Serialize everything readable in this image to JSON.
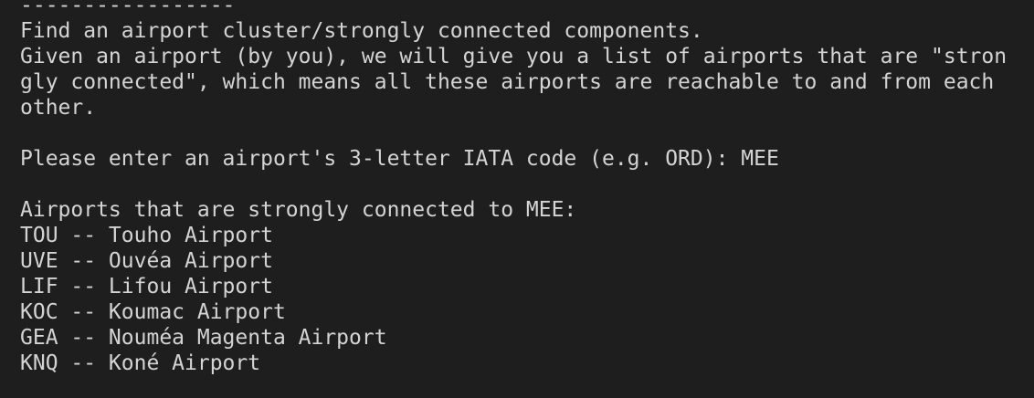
{
  "terminal": {
    "separator": "-----------------",
    "heading": "Find an airport cluster/strongly connected components.",
    "description_lines": [
      "Given an airport (by you), we will give you a list of airports that are \"stron",
      "gly connected\", which means all these airports are reachable to and from each",
      "other."
    ],
    "prompt": "Please enter an airport's 3-letter IATA code (e.g. ORD): ",
    "input_value": "MEE",
    "result_header": "Airports that are strongly connected to MEE:",
    "airports": [
      "TOU -- Touho Airport",
      "UVE -- Ouvéa Airport",
      "LIF -- Lifou Airport",
      "KOC -- Koumac Airport",
      "GEA -- Nouméa Magenta Airport",
      "KNQ -- Koné Airport"
    ]
  },
  "colors": {
    "background": "#1e1e1e",
    "text": "#d4d4d4"
  }
}
